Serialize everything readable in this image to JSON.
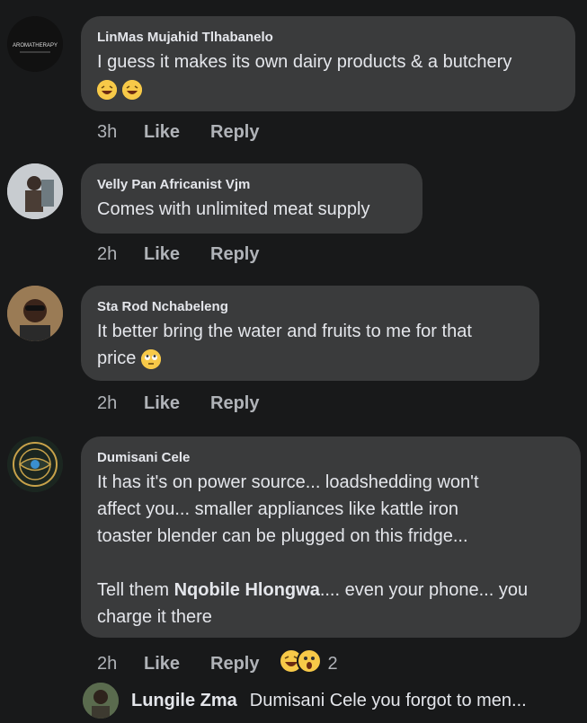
{
  "comments": [
    {
      "author": "LinMas Mujahid Tlhabanelo",
      "text_lines": [
        "I guess it makes its own dairy products & a butchery"
      ],
      "emojis": [
        "laughing-face",
        "laughing-face"
      ],
      "time": "3h",
      "like": "Like",
      "reply": "Reply",
      "avatar_text": "AROMATHERAPY"
    },
    {
      "author": "Velly Pan Africanist Vjm",
      "text_lines": [
        "Comes with unlimited meat supply"
      ],
      "time": "2h",
      "like": "Like",
      "reply": "Reply"
    },
    {
      "author": "Sta Rod Nchabeleng",
      "text_lines": [
        "It better bring the water and fruits to me for that",
        "price"
      ],
      "emojis": [
        "eye-roll-face"
      ],
      "time": "2h",
      "like": "Like",
      "reply": "Reply"
    },
    {
      "author": "Dumisani Cele",
      "text_lines": [
        "It has it's on power source... loadshedding won't",
        "affect you... smaller appliances like kattle iron",
        "toaster blender can be plugged on this fridge..."
      ],
      "mention_line_prefix": "Tell them ",
      "mention": "Nqobile Hlongwa",
      "mention_line_suffix": ".... even your phone... you",
      "last_line": "charge it there",
      "time": "2h",
      "like": "Like",
      "reply": "Reply",
      "reaction_count": "2",
      "reaction_icons": [
        "laughing-face",
        "wow-face"
      ]
    }
  ],
  "reply_preview": {
    "author": "Lungile Zma",
    "text": "Dumisani Cele you forgot to men..."
  }
}
